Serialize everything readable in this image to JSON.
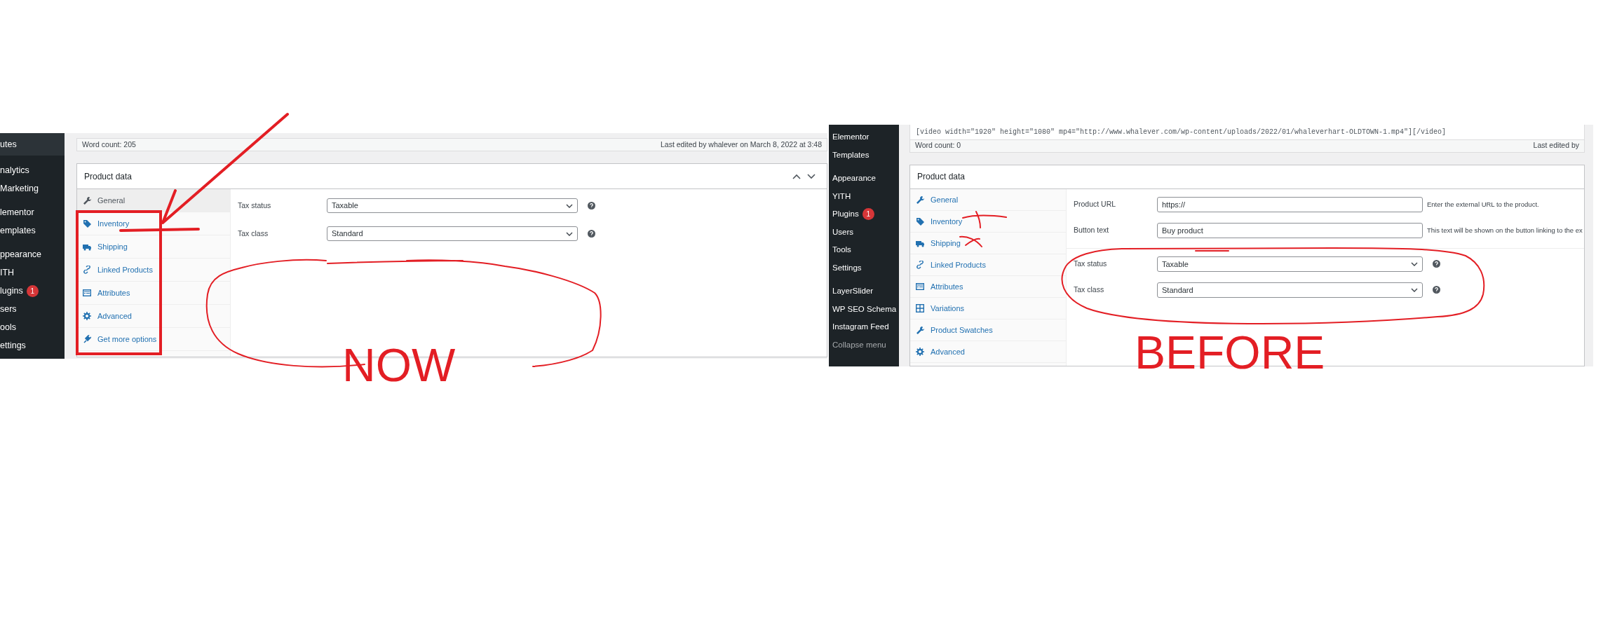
{
  "screenshots": [
    {
      "caption": "NOW",
      "sidebar": {
        "groups": [
          [
            {
              "label": "utes",
              "selected": true
            }
          ],
          [
            {
              "label": "nalytics",
              "selected": false
            },
            {
              "label": "Marketing",
              "selected": false
            }
          ],
          [
            {
              "label": "lementor",
              "selected": false
            },
            {
              "label": "emplates",
              "selected": false
            }
          ],
          [
            {
              "label": "ppearance",
              "selected": false
            },
            {
              "label": "ITH",
              "selected": false
            },
            {
              "label": "lugins",
              "badge": "1",
              "selected": false
            },
            {
              "label": "sers",
              "selected": false
            },
            {
              "label": "ools",
              "selected": false
            },
            {
              "label": "ettings",
              "selected": false
            }
          ]
        ]
      },
      "word_count": "Word count: 205",
      "last_edited": "Last edited by whalever on March 8, 2022 at 3:48",
      "product_data": {
        "title": "Product data",
        "collapse_controls": true,
        "tabs": [
          {
            "label": "General",
            "kind": "general",
            "selected": true
          },
          {
            "label": "Inventory",
            "kind": "inventory",
            "selected": false
          },
          {
            "label": "Shipping",
            "kind": "shipping",
            "selected": false
          },
          {
            "label": "Linked Products",
            "kind": "linked",
            "selected": false
          },
          {
            "label": "Attributes",
            "kind": "attributes",
            "selected": false
          },
          {
            "label": "Advanced",
            "kind": "advanced",
            "selected": false
          },
          {
            "label": "Get more options",
            "kind": "more",
            "selected": false
          }
        ],
        "field_groups": [
          [
            {
              "label": "Tax status",
              "kind": "select",
              "value": "Taxable",
              "help": true
            },
            {
              "label": "Tax class",
              "kind": "select",
              "value": "Standard",
              "help": true
            }
          ]
        ]
      }
    },
    {
      "caption": "BEFORE",
      "code_line": "[video width=\"1920\" height=\"1080\" mp4=\"http://www.whalever.com/wp-content/uploads/2022/01/whaleverhart-OLDTOWN-1.mp4\"][/video]",
      "sidebar": {
        "groups": [
          [
            {
              "label": "Elementor",
              "selected": false
            },
            {
              "label": "Templates",
              "selected": false
            }
          ],
          [
            {
              "label": "Appearance",
              "selected": false
            },
            {
              "label": "YITH",
              "selected": false
            },
            {
              "label": "Plugins",
              "badge": "1",
              "selected": false
            },
            {
              "label": "Users",
              "selected": false
            },
            {
              "label": "Tools",
              "selected": false
            },
            {
              "label": "Settings",
              "selected": false
            }
          ],
          [
            {
              "label": "LayerSlider",
              "selected": false
            },
            {
              "label": "WP SEO Schema",
              "selected": false
            },
            {
              "label": "Instagram Feed",
              "selected": false
            },
            {
              "label": "Collapse menu",
              "kind": "collapse",
              "selected": false
            }
          ]
        ]
      },
      "word_count": "Word count: 0",
      "last_edited": "Last edited by",
      "product_data": {
        "title": "Product data",
        "tabs": [
          {
            "label": "General",
            "kind": "general",
            "selected": false
          },
          {
            "label": "Inventory",
            "kind": "inventory",
            "selected": false
          },
          {
            "label": "Shipping",
            "kind": "shipping",
            "selected": false
          },
          {
            "label": "Linked Products",
            "kind": "linked",
            "selected": false
          },
          {
            "label": "Attributes",
            "kind": "attributes",
            "selected": false
          },
          {
            "label": "Variations",
            "kind": "variations",
            "selected": false
          },
          {
            "label": "Product Swatches",
            "kind": "general",
            "selected": false
          },
          {
            "label": "Advanced",
            "kind": "advanced",
            "selected": false
          }
        ],
        "field_groups": [
          [
            {
              "label": "Product URL",
              "kind": "text",
              "value": "https://",
              "description": "Enter the external URL to the product."
            },
            {
              "label": "Button text",
              "kind": "text",
              "value": "Buy product",
              "description": "This text will be shown on the button linking to the ex"
            }
          ],
          [
            {
              "label": "Tax status",
              "kind": "select",
              "value": "Taxable",
              "help": true
            },
            {
              "label": "Tax class",
              "kind": "select",
              "value": "Standard",
              "help": true
            }
          ]
        ]
      }
    }
  ]
}
